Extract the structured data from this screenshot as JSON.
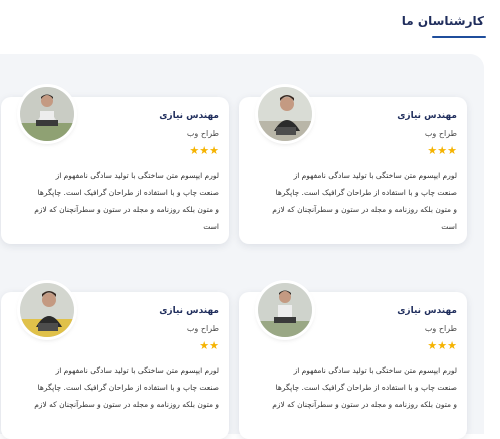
{
  "section": {
    "title": "کارشناسان ما"
  },
  "experts": [
    {
      "name": "مهندس نیازی",
      "role": "طراح وب",
      "rating": 3,
      "stars": "★★★",
      "lines": [
        "لورم ایپسوم متن ساختگی با تولید سادگی نامفهوم از",
        "صنعت چاپ و با استفاده از طراحان گرافیک است. چاپگرها",
        "و متون بلکه روزنامه و مجله در ستون و سطرآنچنان که لازم",
        "است"
      ]
    },
    {
      "name": "مهندس نیازی",
      "role": "طراح وب",
      "rating": 3,
      "stars": "★★★",
      "lines": [
        "لورم ایپسوم متن ساختگی با تولید سادگی نامفهوم از",
        "صنعت چاپ و با استفاده از طراحان گرافیک است. چاپگرها",
        "و متون بلکه روزنامه و مجله در ستون و سطرآنچنان که لازم",
        "است"
      ]
    },
    {
      "name": "مهندس نیازی",
      "role": "طراح وب",
      "rating": 3,
      "stars": "★★★",
      "lines": [
        "لورم ایپسوم متن ساختگی با تولید سادگی نامفهوم از",
        "صنعت چاپ و با استفاده از طراحان گرافیک است. چاپگرها",
        "و متون بلکه روزنامه و مجله در ستون و سطرآنچنان که لازم"
      ]
    },
    {
      "name": "مهندس نیازی",
      "role": "طراح وب",
      "rating": 2,
      "stars": "★★",
      "lines": [
        "لورم ایپسوم متن ساختگی با تولید سادگی نامفهوم از",
        "صنعت چاپ و با استفاده از طراحان گرافیک است. چاپگرها",
        "و متون بلکه روزنامه و مجله در ستون و سطرآنچنان که لازم"
      ]
    }
  ]
}
